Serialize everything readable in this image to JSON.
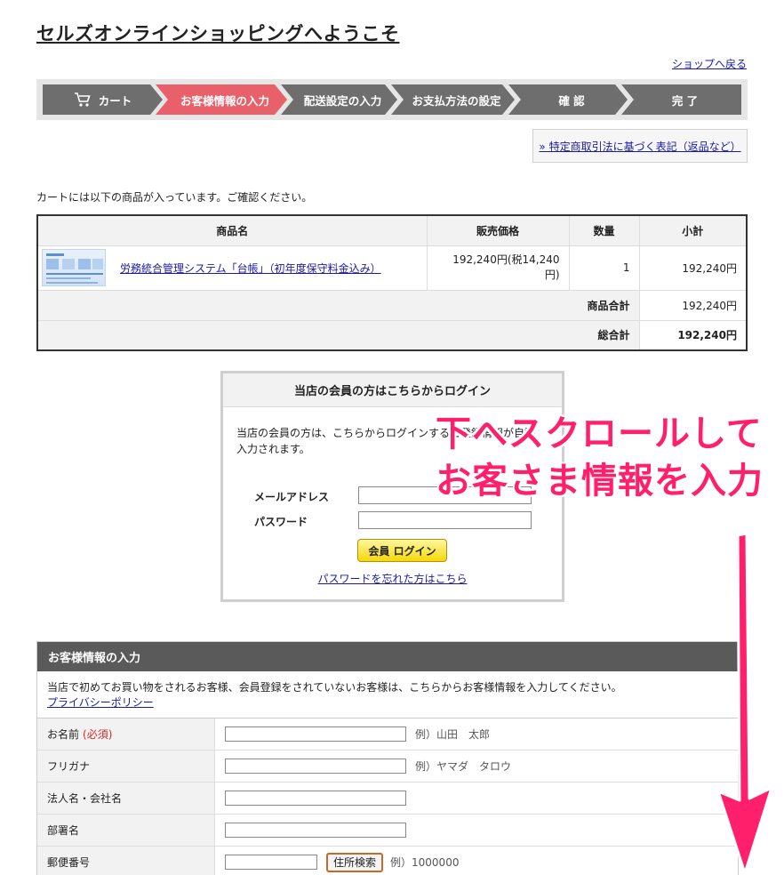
{
  "page": {
    "title": "セルズオンラインショッピングへようこそ",
    "back_link": "ショップへ戻る",
    "legal_link": "» 特定商取引法に基づく表記（返品など）",
    "cart_message": "カートには以下の商品が入っています。ご確認ください。"
  },
  "steps": [
    {
      "label": "カート",
      "active": false
    },
    {
      "label": "お客様情報の入力",
      "active": true
    },
    {
      "label": "配送設定の入力",
      "active": false
    },
    {
      "label": "お支払方法の設定",
      "active": false
    },
    {
      "label": "確 認",
      "active": false
    },
    {
      "label": "完 了",
      "active": false
    }
  ],
  "cart": {
    "headers": {
      "product": "商品名",
      "price": "販売価格",
      "qty": "数量",
      "subtotal": "小計"
    },
    "item": {
      "name": "労務統合管理システム「台帳」（初年度保守料金込み）",
      "price_line1": "192,240円(税14,240",
      "price_line2": "円)",
      "qty": "1",
      "subtotal": "192,240円"
    },
    "goods_total_label": "商品合計",
    "goods_total": "192,240円",
    "grand_total_label": "総合計",
    "grand_total": "192,240円"
  },
  "login": {
    "heading": "当店の会員の方はこちらからログイン",
    "description": "当店の会員の方は、こちらからログインすると登録情報が自動入力されます。",
    "email_label": "メールアドレス",
    "password_label": "パスワード",
    "button": "会員 ログイン",
    "forgot": "パスワードを忘れた方はこちら"
  },
  "overlay": {
    "line1": "下へスクロールして",
    "line2": "お客さま情報を入力",
    "color": "#ff1f6a"
  },
  "customer_form": {
    "heading": "お客様情報の入力",
    "description": "当店で初めてお買い物をされるお客様、会員登録をされていないお客様は、こちらからお客様情報を入力してください。",
    "privacy_link": "プライバシーポリシー",
    "rows": {
      "name": {
        "label": "お名前",
        "required": "(必須)",
        "hint": "例）山田　太郎"
      },
      "kana": {
        "label": "フリガナ",
        "hint": "例）ヤマダ　タロウ"
      },
      "company": {
        "label": "法人名・会社名"
      },
      "dept": {
        "label": "部署名"
      },
      "zip": {
        "label": "郵便番号",
        "button": "住所検索",
        "hint": "例）1000000"
      }
    }
  }
}
